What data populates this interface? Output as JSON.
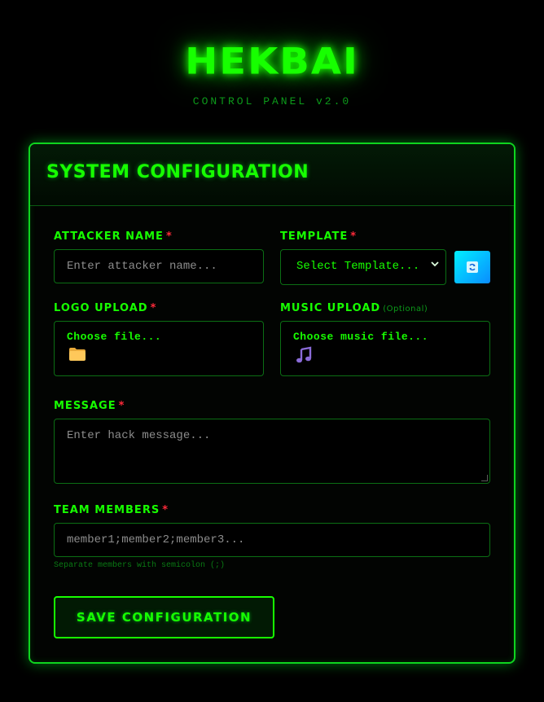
{
  "brand": {
    "title": "HEKBAI",
    "subtitle": "CONTROL PANEL v2.0"
  },
  "panel": {
    "title": "SYSTEM CONFIGURATION"
  },
  "form": {
    "attacker_name": {
      "label": "ATTACKER NAME",
      "required": "*",
      "placeholder": "Enter attacker name..."
    },
    "template": {
      "label": "TEMPLATE",
      "required": "*",
      "selected": "Select Template...",
      "refresh_icon": "refresh-icon"
    },
    "logo_upload": {
      "label": "LOGO UPLOAD",
      "required": "*",
      "button": "Choose file...",
      "icon": "folder-icon"
    },
    "music_upload": {
      "label": "MUSIC UPLOAD",
      "optional": "(Optional)",
      "button": "Choose music file...",
      "icon": "music-note-icon"
    },
    "message": {
      "label": "MESSAGE",
      "required": "*",
      "placeholder": "Enter hack message..."
    },
    "team_members": {
      "label": "TEAM MEMBERS",
      "required": "*",
      "placeholder": "member1;member2;member3...",
      "hint": "Separate members with semicolon (;)"
    },
    "save_label": "SAVE CONFIGURATION"
  },
  "colors": {
    "accent": "#17ff00",
    "required": "#ff2a3a",
    "background": "#000000",
    "refresh_button": "#00c8ff"
  }
}
